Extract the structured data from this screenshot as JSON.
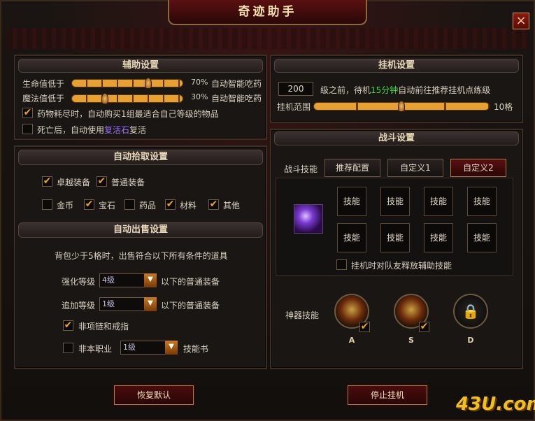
{
  "window": {
    "title": "奇迹助手",
    "close_label": "×"
  },
  "assist": {
    "heading": "辅助设置",
    "hp_label": "生命值低于",
    "hp_percent": "70%",
    "hp_level": 0.7,
    "hp_action": "自动智能吃药",
    "mp_label": "魔法值低于",
    "mp_percent": "30%",
    "mp_level": 0.3,
    "mp_action": "自动智能吃药",
    "potion_text": "药物耗尽时，自动购买1组最适合自己等级的物品",
    "revive_prefix": "死亡后，自动使用",
    "revive_item": "复活石",
    "revive_suffix": "复活",
    "potion_checked": true,
    "revive_checked": false
  },
  "pickup": {
    "heading": "自动拾取设置",
    "items": [
      {
        "label": "卓越装备",
        "checked": true
      },
      {
        "label": "普通装备",
        "checked": true
      },
      {
        "label": "金币",
        "checked": false
      },
      {
        "label": "宝石",
        "checked": true
      },
      {
        "label": "药品",
        "checked": false
      },
      {
        "label": "材料",
        "checked": true
      },
      {
        "label": "其他",
        "checked": true
      }
    ]
  },
  "sell": {
    "heading": "自动出售设置",
    "intro": "背包少于5格时，出售符合以下所有条件的道具",
    "enhance_label": "强化等级",
    "enhance_value": "4级",
    "enhance_suffix": "以下的普通装备",
    "add_label": "追加等级",
    "add_value": "1级",
    "add_suffix": "以下的普通装备",
    "ring_label": "非项链和戒指",
    "ring_checked": true,
    "class_label": "非本职业",
    "class_value": "1级",
    "class_suffix": "技能书",
    "class_checked": false
  },
  "idle": {
    "heading": "挂机设置",
    "level_value": "200",
    "text_before": "级之前，待机",
    "minutes": "15分钟",
    "text_after": "自动前往推荐挂机点练级",
    "range_label": "挂机范围",
    "range_value": "10格",
    "range_level": 0.5
  },
  "battle": {
    "heading": "战斗设置",
    "skills_label": "战斗技能",
    "tabs": [
      "推荐配置",
      "自定义1",
      "自定义2"
    ],
    "active_tab": 2,
    "slots": [
      "技能",
      "技能",
      "技能",
      "技能",
      "技能",
      "技能",
      "技能",
      "技能"
    ],
    "support_label": "挂机时对队友释放辅助技能",
    "support_checked": false,
    "artifact_label": "神器技能",
    "artifacts": [
      {
        "key": "A",
        "icon": "artifact-a-icon",
        "checked": true
      },
      {
        "key": "S",
        "icon": "artifact-s-icon",
        "checked": true
      },
      {
        "key": "D",
        "icon": "lock-icon",
        "checked": false
      }
    ]
  },
  "footer": {
    "restore_label": "恢复默认",
    "stop_label": "停止挂机",
    "logo": "43U.com"
  },
  "colors": {
    "accent_orange": "#f0a020",
    "minutes_green": "#40e040",
    "revive_purple": "#9a70ff",
    "title_red": "#5a1010"
  }
}
